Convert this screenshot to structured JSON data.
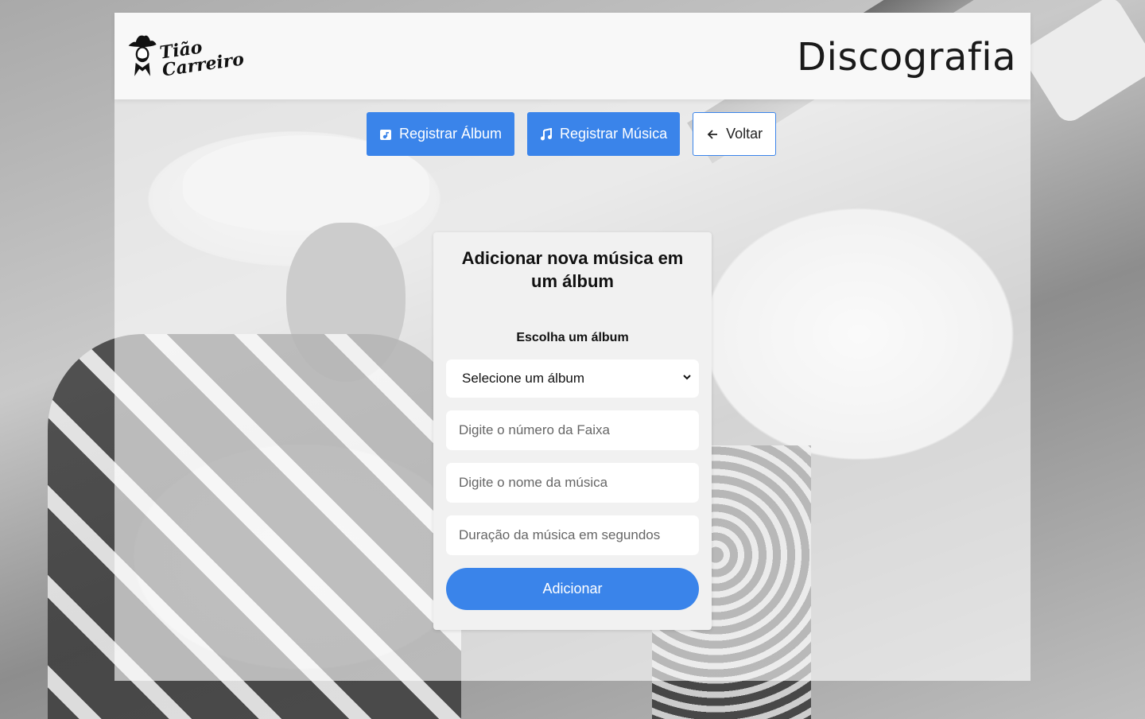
{
  "header": {
    "logo_text": "Tião Carreiro",
    "title": "Discografia"
  },
  "actions": {
    "register_album": "Registrar Álbum",
    "register_music": "Registrar Música",
    "back": "Voltar"
  },
  "form": {
    "title": "Adicionar nova música em um álbum",
    "album_label": "Escolha um álbum",
    "album_select_value": "Selecione um álbum",
    "track_number_placeholder": "Digite o número da Faixa",
    "song_name_placeholder": "Digite o nome da música",
    "duration_placeholder": "Duração da música em segundos",
    "submit_label": "Adicionar"
  },
  "colors": {
    "primary": "#3a84ea",
    "header_bg": "#f8f8f8",
    "card_bg": "#f1f1f1"
  }
}
